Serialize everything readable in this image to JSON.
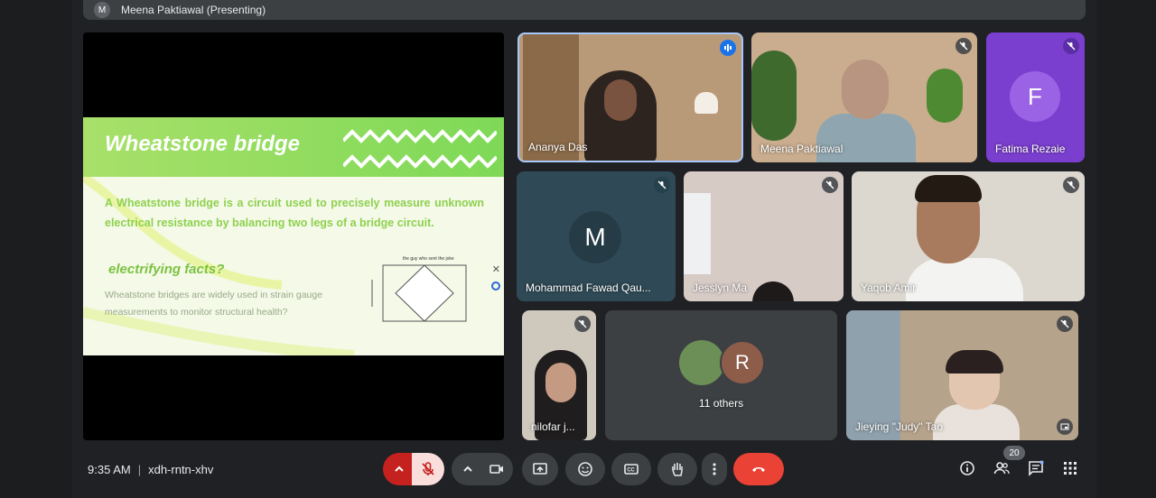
{
  "presenter_bar": {
    "avatar_letter": "M",
    "label": "Meena Paktiawal (Presenting)"
  },
  "slide": {
    "title": "Wheatstone bridge",
    "body": "A Wheatstone bridge is a circuit used to precisely measure unknown electrical resistance by balancing two legs of a bridge circuit.",
    "subtitle": "electrifying facts?",
    "small_text": "Wheatstone bridges are widely used in strain gauge measurements to monitor structural health?",
    "diagram_caption": "the guy who sent the joke"
  },
  "participants": [
    {
      "name": "Ananya Das",
      "status": "speaking"
    },
    {
      "name": "Meena Paktiawal",
      "status": "muted"
    },
    {
      "name": "Fatima Rezaie",
      "avatar_letter": "F",
      "status": "muted"
    },
    {
      "name": "Mohammad Fawad Qau...",
      "avatar_letter": "M",
      "status": "muted"
    },
    {
      "name": "Jesslyn Ma",
      "status": "muted"
    },
    {
      "name": "Yaqob Amir",
      "status": "muted"
    },
    {
      "name": "nilofar j...",
      "status": "muted"
    },
    {
      "name": "11 others",
      "avatar_letter": "R"
    },
    {
      "name": "Jieying \"Judy\" Tao",
      "status": "muted"
    }
  ],
  "meeting": {
    "time": "9:35 AM",
    "separator": "|",
    "code": "xdh-rntn-xhv"
  },
  "people_count": "20",
  "colors": {
    "accent_red": "#ea4335",
    "tile_bg": "#3c4043",
    "purple": "#7b3fcf"
  }
}
